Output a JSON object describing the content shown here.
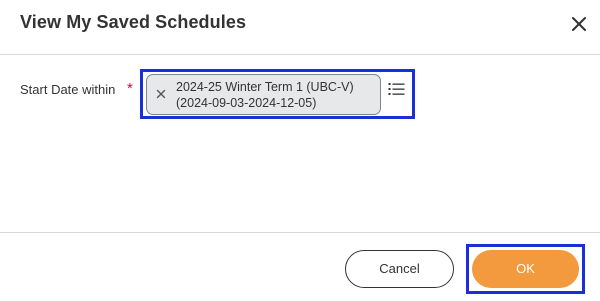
{
  "dialog": {
    "title": "View My Saved Schedules"
  },
  "icons": {
    "close": "close-icon",
    "remove": "remove-icon",
    "list": "list-icon"
  },
  "field": {
    "label": "Start Date within",
    "required_marker": "*",
    "selected_value_line1": "2024-25 Winter Term 1 (UBC-V)",
    "selected_value_line2": "(2024-09-03-2024-12-05)"
  },
  "footer": {
    "cancel_label": "Cancel",
    "ok_label": "OK"
  },
  "colors": {
    "primary_button": "#f29a3d",
    "required": "#c8102e",
    "highlight_outline": "#1a2fd8",
    "pill_background": "#e6e8ea"
  }
}
